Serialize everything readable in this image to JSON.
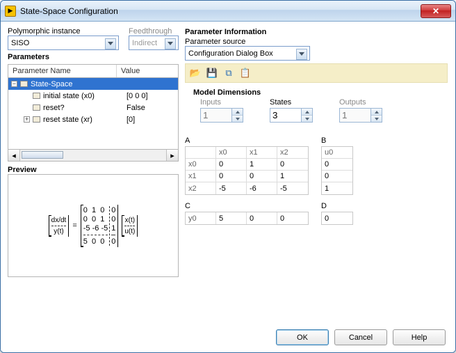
{
  "window": {
    "title": "State-Space Configuration"
  },
  "left": {
    "poly_label": "Polymorphic instance",
    "poly_value": "SISO",
    "feed_label": "Feedthrough",
    "feed_value": "Indirect",
    "parameters_header": "Parameters",
    "col_name": "Parameter Name",
    "col_value": "Value",
    "tree": [
      {
        "name": "State-Space",
        "value": "",
        "selected": true,
        "indent": 0
      },
      {
        "name": "initial state (x0)",
        "value": "[0 0 0]",
        "indent": 1
      },
      {
        "name": "reset?",
        "value": "False",
        "indent": 1
      },
      {
        "name": "reset state (xr)",
        "value": "[0]",
        "indent": 1
      }
    ],
    "preview_label": "Preview"
  },
  "right": {
    "title": "Parameter Information",
    "src_label": "Parameter source",
    "src_value": "Configuration Dialog Box",
    "model_dim": "Model Dimensions",
    "inputs_label": "Inputs",
    "states_label": "States",
    "outputs_label": "Outputs",
    "inputs": "1",
    "states": "3",
    "outputs": "1",
    "A_label": "A",
    "B_label": "B",
    "C_label": "C",
    "D_label": "D",
    "A_cols": [
      "",
      "x0",
      "x1",
      "x2"
    ],
    "A": [
      [
        "x0",
        "0",
        "1",
        "0"
      ],
      [
        "x1",
        "0",
        "0",
        "1"
      ],
      [
        "x2",
        "-5",
        "-6",
        "-5"
      ]
    ],
    "B_cols": [
      "u0"
    ],
    "B": [
      [
        "0"
      ],
      [
        "0"
      ],
      [
        "1"
      ]
    ],
    "C_cols": [
      "y0",
      "5",
      "0",
      "0"
    ],
    "D_cols": [
      "0"
    ]
  },
  "chart_data": {
    "type": "table",
    "title": "State-Space matrices",
    "A": [
      [
        0,
        1,
        0
      ],
      [
        0,
        0,
        1
      ],
      [
        -5,
        -6,
        -5
      ]
    ],
    "B": [
      [
        0
      ],
      [
        0
      ],
      [
        1
      ]
    ],
    "C": [
      [
        5,
        0,
        0
      ]
    ],
    "D": [
      [
        0
      ]
    ],
    "state_labels": [
      "x0",
      "x1",
      "x2"
    ],
    "input_labels": [
      "u0"
    ],
    "output_labels": [
      "y0"
    ],
    "inputs": 1,
    "states": 3,
    "outputs": 1
  },
  "eq": {
    "lhs_top": "dx/dt",
    "lhs_bot": "y(t)",
    "rhs_top": "x(t)",
    "rhs_bot": "u(t)",
    "r0": [
      "0",
      "1",
      "0",
      "0"
    ],
    "r1": [
      "0",
      "0",
      "1",
      "0"
    ],
    "r2": [
      "-5",
      "-6",
      "-5",
      "1"
    ],
    "r3": [
      "5",
      "0",
      "0",
      "0"
    ]
  },
  "buttons": {
    "ok": "OK",
    "cancel": "Cancel",
    "help": "Help"
  }
}
